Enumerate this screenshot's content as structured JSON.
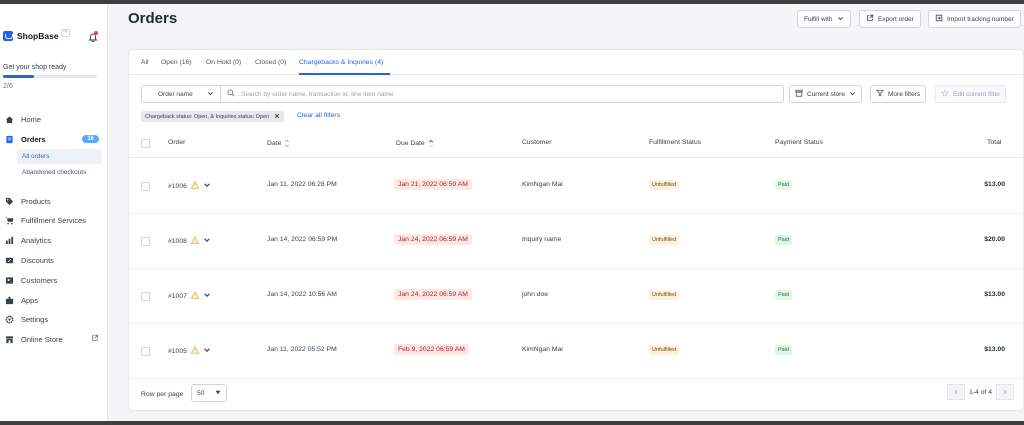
{
  "sidebar": {
    "brand": "ShopBase",
    "brand_badge": "™",
    "setup_title": "Get your shop ready",
    "setup_progress": 0.33,
    "setup_count": "2/6",
    "nav": {
      "home": "Home",
      "orders": "Orders",
      "orders_count": "16",
      "all_orders": "All orders",
      "abandoned": "Abandoned checkouts",
      "products": "Products",
      "fulfillment": "Fulfillment Services",
      "analytics": "Analytics",
      "discounts": "Discounts",
      "customers": "Customers",
      "apps": "Apps",
      "settings": "Settings",
      "online_store": "Online Store"
    }
  },
  "header": {
    "title": "Orders",
    "fulfill_with": "Fulfill with",
    "export": "Export order",
    "import": "Import tracking number"
  },
  "tabs": [
    "All",
    "Open (16)",
    "On Hold (0)",
    "Closed (0)",
    "Chargebacks & Inquiries (4)"
  ],
  "filters": {
    "search_by": "Order name",
    "search_placeholder": "Search by order name, transaction id, line item name",
    "current_store": "Current store",
    "more_filters": "More filters",
    "edit_filter": "Edit current filter",
    "chip": "Chargeback status: Open, & Inquiries status: Open",
    "clear_all": "Clear all filters"
  },
  "table": {
    "headers": {
      "order": "Order",
      "date": "Date",
      "due_date": "Due Date",
      "customer": "Customer",
      "fulfillment": "Fulfillment Status",
      "payment": "Payment Status",
      "total": "Total"
    },
    "rows": [
      {
        "order": "#1006",
        "date": "Jan 11, 2022 06:28 PM",
        "due": "Jan 21, 2022 06:59 AM",
        "customer": "KimNgan Mai",
        "fulfillment": "Unfulfilled",
        "payment": "Paid",
        "total": "$13.00"
      },
      {
        "order": "#1008",
        "date": "Jan 14, 2022 06:59 PM",
        "due": "Jan 24, 2022 06:59 AM",
        "customer": "Inquiry name",
        "fulfillment": "Unfulfilled",
        "payment": "Paid",
        "total": "$20.00"
      },
      {
        "order": "#1007",
        "date": "Jan 14, 2022 10:56 AM",
        "due": "Jan 24, 2022 06:59 AM",
        "customer": "john doe",
        "fulfillment": "Unfulfilled",
        "payment": "Paid",
        "total": "$13.00"
      },
      {
        "order": "#1005",
        "date": "Jan 11, 2022 05:52 PM",
        "due": "Feb 9, 2022 06:59 AM",
        "customer": "KimNgan Mai",
        "fulfillment": "Unfulfilled",
        "payment": "Paid",
        "total": "$13.00"
      }
    ]
  },
  "footer": {
    "rows_per_page_label": "Row per page",
    "rows_per_page": "50",
    "page_info": "1-4 of 4"
  },
  "colors": {
    "accent": "#2563eb",
    "due_bg": "#fde8e8",
    "due_text": "#b91c1c",
    "paid_bg": "#e3f5e8",
    "unfulfilled_bg": "#fdf1dd"
  }
}
